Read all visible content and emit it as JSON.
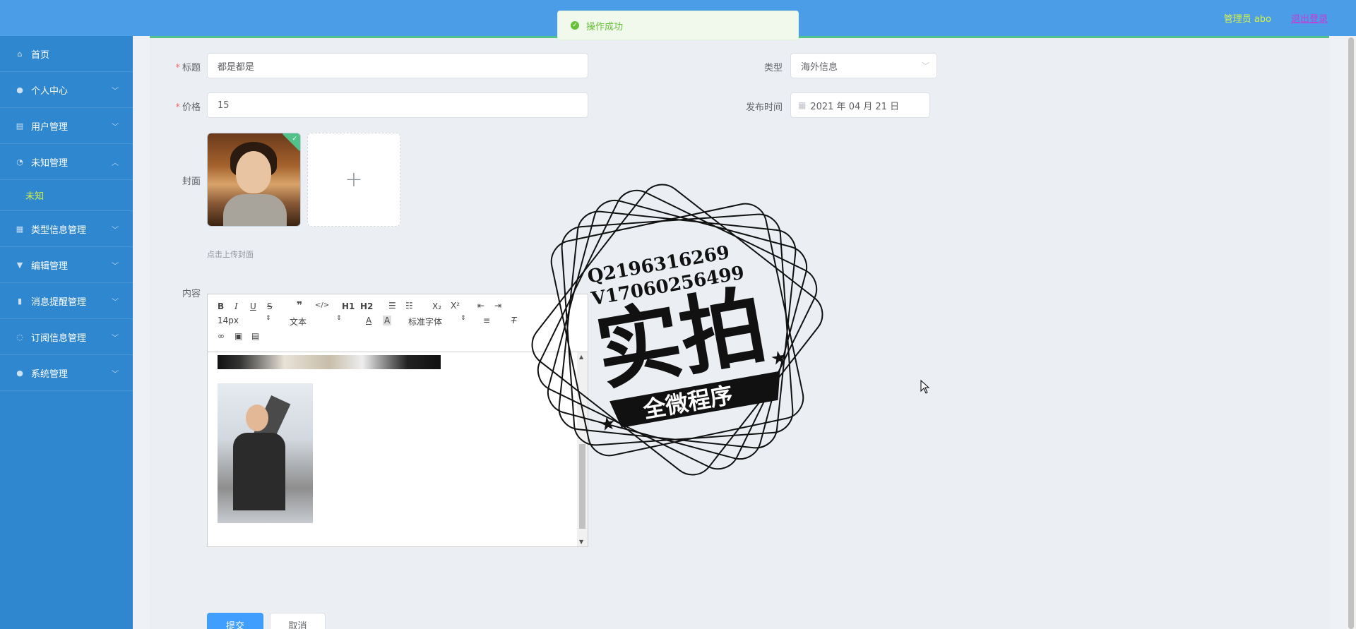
{
  "header": {
    "user_label": "管理员 abo",
    "logout_label": "退出登录"
  },
  "toast": {
    "message": "操作成功"
  },
  "sidebar": {
    "items": [
      {
        "label": "首页",
        "icon": "home-icon"
      },
      {
        "label": "个人中心",
        "icon": "user-icon"
      },
      {
        "label": "用户管理",
        "icon": "clipboard-icon"
      },
      {
        "label": "未知管理",
        "icon": "clock-icon"
      },
      {
        "label": "类型信息管理",
        "icon": "grid-icon"
      },
      {
        "label": "编辑管理",
        "icon": "cup-icon"
      },
      {
        "label": "消息提醒管理",
        "icon": "bar-chart-icon"
      },
      {
        "label": "订阅信息管理",
        "icon": "bell-icon"
      },
      {
        "label": "系统管理",
        "icon": "location-icon"
      }
    ],
    "submenu": {
      "label": "未知"
    },
    "colors": {
      "background": "#2f87d0",
      "active_text": "#d6f24b"
    }
  },
  "form": {
    "title_label": "标题",
    "title_value": "都是都是",
    "type_label": "类型",
    "type_value": "海外信息",
    "price_label": "价格",
    "price_value": "15",
    "date_label": "发布时间",
    "date_value": "2021 年 04 月 21 日",
    "cover_label": "封面",
    "cover_hint": "点击上传封面",
    "content_label": "内容",
    "submit_label": "提交",
    "cancel_label": "取消"
  },
  "editor": {
    "font_size": "14px",
    "block_format": "文本",
    "font_family": "标准字体",
    "h1": "H1",
    "h2": "H2"
  },
  "watermark": {
    "line1": "Q2196316269",
    "line2": "V17060256499",
    "main": "实拍",
    "banner": "全微程序"
  }
}
